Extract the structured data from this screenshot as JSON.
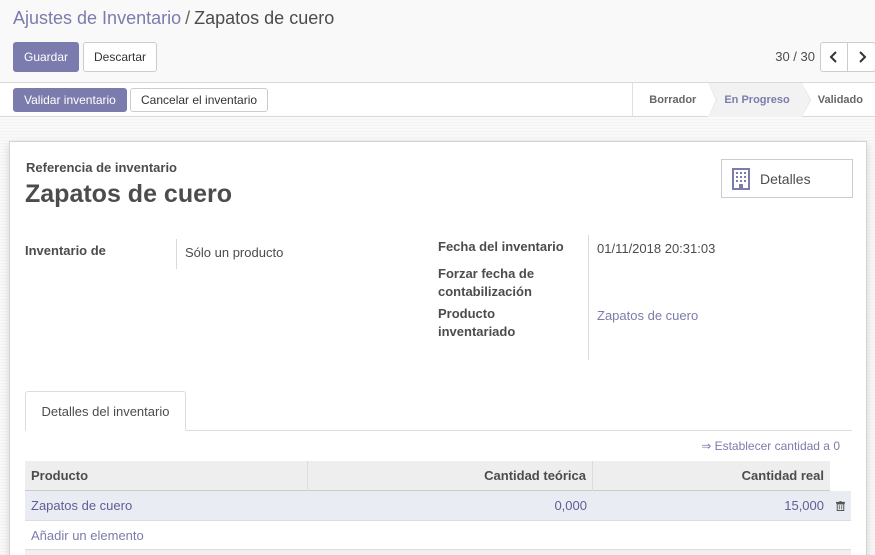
{
  "breadcrumb": {
    "parent": "Ajustes de Inventario",
    "separator": "/",
    "current": "Zapatos de cuero"
  },
  "toolbar": {
    "save_label": "Guardar",
    "discard_label": "Descartar"
  },
  "pager": {
    "value": "30 / 30",
    "prev_icon": "chevron-left-icon",
    "next_icon": "chevron-right-icon"
  },
  "statusbar": {
    "validate_label": "Validar inventario",
    "cancel_label": "Cancelar el inventario",
    "stages": [
      {
        "label": "Borrador",
        "active": false
      },
      {
        "label": "En Progreso",
        "active": true
      },
      {
        "label": "Validado",
        "active": false
      }
    ]
  },
  "form": {
    "ref_label": "Referencia de inventario",
    "title": "Zapatos de cuero",
    "details_button": "Detalles",
    "details_icon": "building-icon",
    "inventory_of_label": "Inventario de",
    "inventory_of_value": "Sólo un producto",
    "date_label": "Fecha del inventario",
    "date_value": "01/11/2018 20:31:03",
    "force_date_label_1": "Forzar fecha de",
    "force_date_label_2": "contabilización",
    "product_label_1": "Producto",
    "product_label_2": "inventariado",
    "product_value": "Zapatos de cuero"
  },
  "tabs": [
    {
      "label": "Detalles del inventario",
      "active": true
    }
  ],
  "set_quantity_link": "⇒ Establecer cantidad a 0",
  "table": {
    "columns": [
      "Producto",
      "Cantidad teórica",
      "Cantidad real"
    ],
    "rows": [
      {
        "product": "Zapatos de cuero",
        "theoretical": "0,000",
        "real": "15,000"
      }
    ],
    "add_line": "Añadir un elemento",
    "delete_icon": "trash-icon"
  },
  "colors": {
    "accent": "#7c7bad",
    "link": "#5f5e97",
    "row_highlight": "#e9ecf2"
  }
}
